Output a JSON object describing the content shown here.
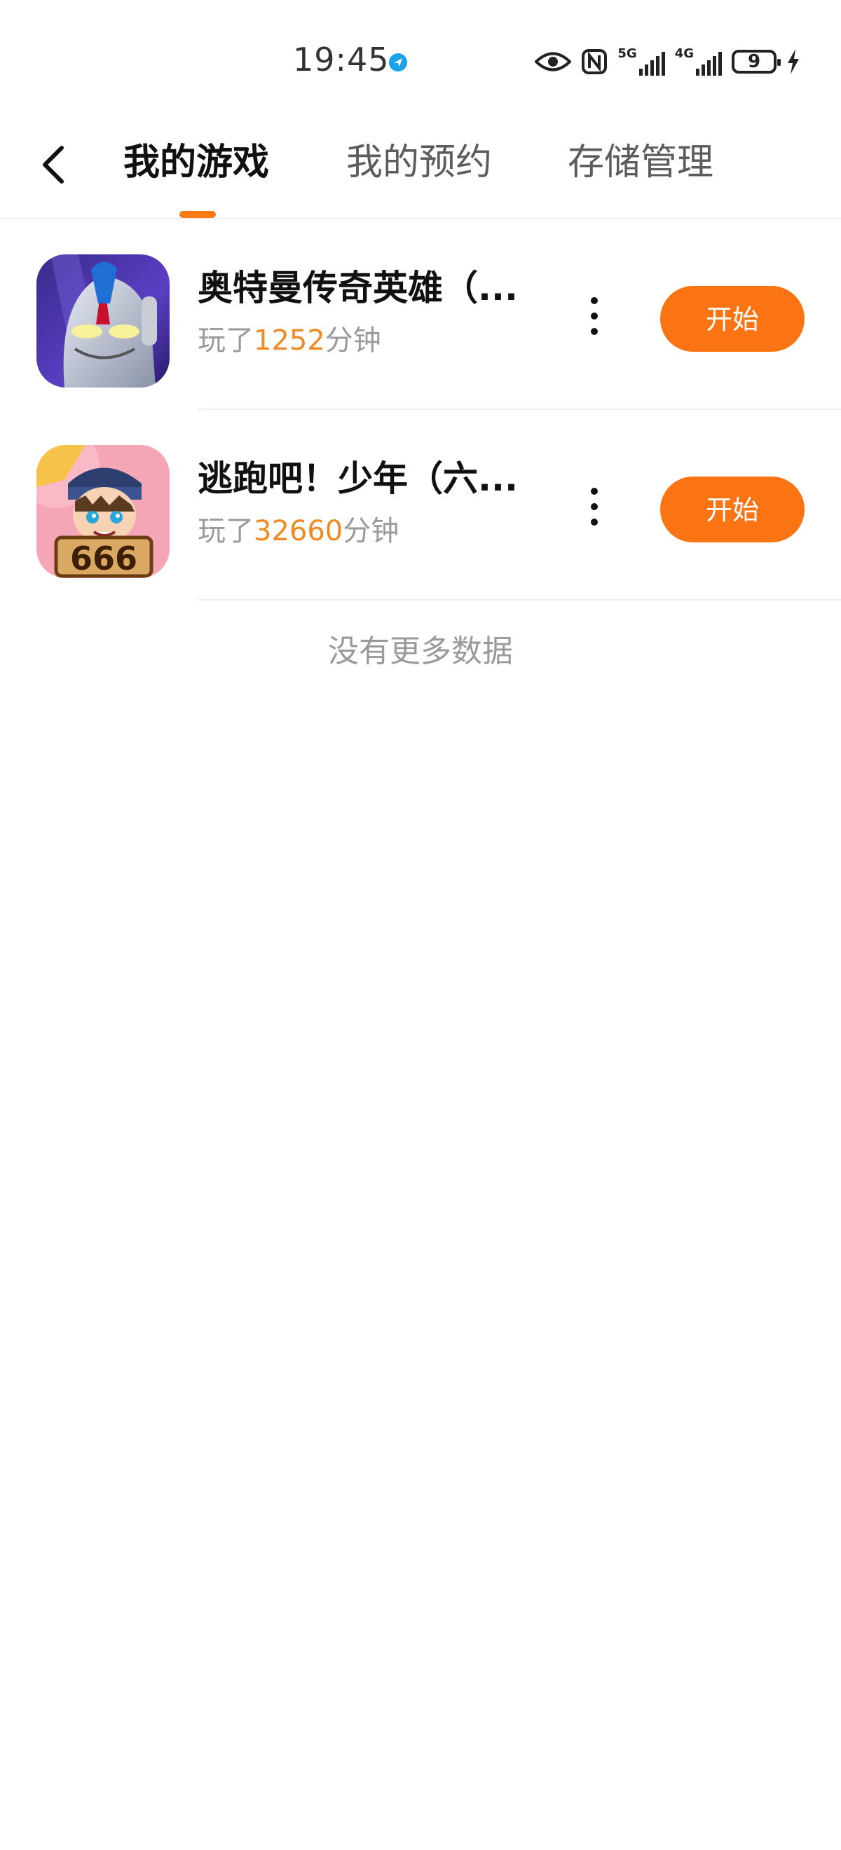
{
  "status_bar": {
    "time": "19:45",
    "network_5g": "5G",
    "network_4g": "4G",
    "battery_level": "9",
    "icons": [
      "location-dot-icon",
      "eye-icon",
      "nfc-icon",
      "signal-5g-icon",
      "signal-4g-icon",
      "battery-icon",
      "charging-icon"
    ]
  },
  "header": {
    "tabs": [
      {
        "label": "我的游戏",
        "active": true
      },
      {
        "label": "我的预约",
        "active": false
      },
      {
        "label": "存储管理",
        "active": false
      }
    ],
    "accent_color": "#fb7a12"
  },
  "games": [
    {
      "title": "奥特曼传奇英雄（...",
      "played_prefix": "玩了",
      "played_minutes": "1252",
      "played_suffix": "分钟",
      "start_label": "开始"
    },
    {
      "title": "逃跑吧！少年（六...",
      "played_prefix": "玩了",
      "played_minutes": "32660",
      "played_suffix": "分钟",
      "start_label": "开始"
    }
  ],
  "footer": {
    "no_more_text": "没有更多数据"
  }
}
